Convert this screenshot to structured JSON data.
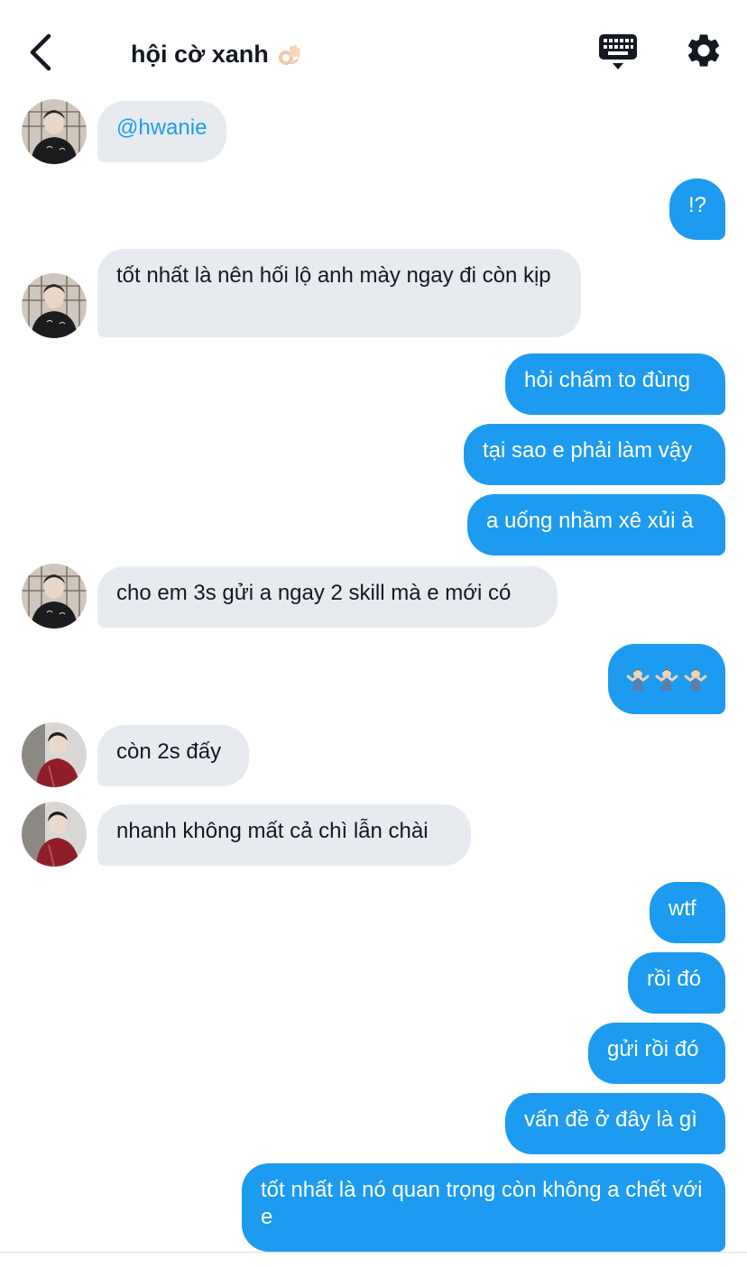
{
  "header": {
    "title": "hội cờ xanh",
    "title_emoji": "ok-hand-emoji"
  },
  "icons": {
    "back": "chevron-left-icon",
    "keyboard": "keyboard-icon",
    "settings": "gear-icon"
  },
  "colors": {
    "outgoing_bubble": "#1d9bf0",
    "incoming_bubble": "#e7ebef",
    "text": "#141823"
  },
  "messages": [
    {
      "dir": "in",
      "text": "@hwanie",
      "avatar": "avatar-black-jacket"
    },
    {
      "dir": "out",
      "text": "!?"
    },
    {
      "dir": "in",
      "text": "tốt nhất là nên hối lộ anh mày ngay đi còn kịp",
      "avatar": "avatar-black-jacket"
    },
    {
      "dir": "out",
      "text": "hỏi chấm to đùng"
    },
    {
      "dir": "out",
      "text": "tại sao e phải làm vậy"
    },
    {
      "dir": "out",
      "text": "a uống nhầm xê xủi à"
    },
    {
      "dir": "in",
      "text": "cho em 3s gửi a ngay 2 skill mà e mới có",
      "avatar": "avatar-black-jacket"
    },
    {
      "dir": "out",
      "text": "",
      "emoji": "man-shrugging-emoji x3"
    },
    {
      "dir": "in",
      "text": "còn 2s đấy",
      "avatar": "avatar-red-jacket"
    },
    {
      "dir": "in",
      "text": "nhanh không mất cả chì lẫn chài",
      "avatar": "avatar-red-jacket"
    },
    {
      "dir": "out",
      "text": "wtf"
    },
    {
      "dir": "out",
      "text": "rồi đó"
    },
    {
      "dir": "out",
      "text": "gửi rồi đó"
    },
    {
      "dir": "out",
      "text": "vấn đề ở đây là gì"
    },
    {
      "dir": "out",
      "text": "tốt nhất là nó quan trọng còn không a chết với e"
    }
  ]
}
